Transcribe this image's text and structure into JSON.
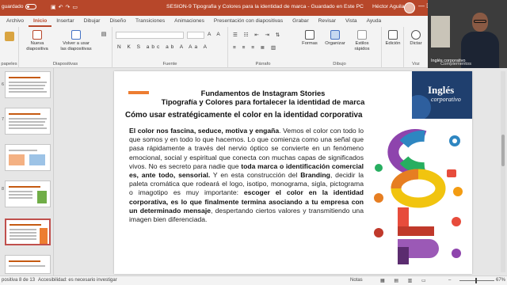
{
  "titlebar": {
    "autosave_label": "guardado",
    "document_title": "SESION-9 Tipografia y Colores para la identidad de marca  -  Guardado en Este PC",
    "user_name": "Héctor Aguilar",
    "window_controls": "—  ☐"
  },
  "ribbon_tabs": [
    "Archivo",
    "Inicio",
    "Insertar",
    "Dibujar",
    "Diseño",
    "Transiciones",
    "Animaciones",
    "Presentación con diapositivas",
    "Grabar",
    "Revisar",
    "Vista",
    "Ayuda"
  ],
  "ribbon": {
    "clipboard_label": "papeles",
    "new_slide_label": "Nueva diapositiva",
    "reuse_slides_label": "Volver a usar las diapositivas",
    "slides_group_label": "Diapositivas",
    "font_group_label": "Fuente",
    "font_format_buttons": "N K S abc ab  A  Aa  A",
    "paragraph_group_label": "Párrafo",
    "drawing_group_label": "Dibujo",
    "shapes_label": "Formas",
    "arrange_label": "Organizar",
    "quick_styles_label": "Estilos rápidos",
    "editing_label": "Edición",
    "voice_group_label": "Voz",
    "dictate_label": "Dictar",
    "complements_label": "Complementos"
  },
  "video": {
    "caption": "Inglés corporativo"
  },
  "thumbnails": [
    {
      "number": ""
    },
    {
      "number": "6"
    },
    {
      "number": "7"
    },
    {
      "number": "8"
    },
    {
      "number": ""
    }
  ],
  "slide": {
    "heading_line1": "Fundamentos de Instagram Stories",
    "heading_line2": "Tipografía y Colores para fortalecer la identidad de marca",
    "subheading": "Cómo usar estratégicamente el color en la identidad corporativa",
    "logo_line1": "Inglés",
    "logo_line2": "corporativo",
    "body": {
      "p1_bold": "El color nos fascina, seduce, motiva y engaña",
      "p1_rest": ". Vemos el color con todo lo que somos y en todo lo que hacemos. Lo que comienza como una señal que pasa rápidamente a través del nervio óptico se convierte en un fenómeno emocional, social y espiritual que conecta con muchas capas de significados vivos. No es secreto para nadie que ",
      "p1_bold2": "toda marca o identificación comercial es, ante todo, sensorial.",
      "p1_rest2": " Y en esta construcción del ",
      "p1_bold3": "Branding",
      "p1_rest3": ", decidir la paleta cromática que rodeará el logo, isotipo, monograma, sigla, pictograma o imagotipo es muy importante: ",
      "p1_bold4": "escoger el color en la identidad corporativa, es lo que finalmente termina asociando a tu empresa con un determinado mensaje",
      "p1_rest4": ", despertando ciertos valores y transmitiendo una imagen bien diferenciada."
    }
  },
  "statusbar": {
    "slide_info": "positiva 8 de 13",
    "accessibility": "Accesibilidad: es necesario investigar",
    "notes_label": "Notas",
    "zoom": "67%"
  }
}
